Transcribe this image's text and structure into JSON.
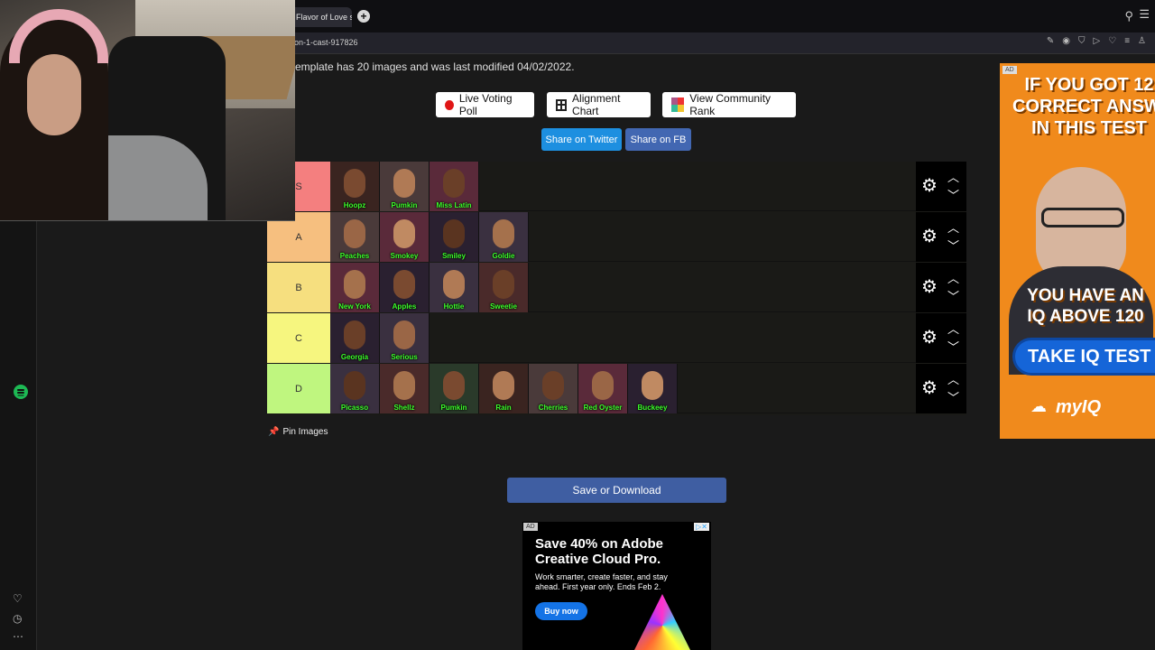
{
  "browser": {
    "tab_title": "Flavor of Love se",
    "url": "on-1-cast-917826",
    "newtab": "+",
    "search_icon": "⚲",
    "menu_icon": "☰"
  },
  "page": {
    "modified_text": "emplate has 20 images and was last modified 04/02/2022.",
    "buttons": {
      "live_voting": "Live Voting Poll",
      "alignment": "Alignment Chart",
      "community_rank": "View Community Rank"
    },
    "share": {
      "twitter": "Share on Twitter",
      "facebook": "Share on FB"
    },
    "pin_images": "Pin Images",
    "save_download": "Save or Download"
  },
  "tiers": [
    {
      "label": "S",
      "color": "#f47f7f",
      "items": [
        "Hoopz",
        "Pumkin",
        "Miss Latin"
      ]
    },
    {
      "label": "A",
      "color": "#f6bf7f",
      "items": [
        "Peaches",
        "Smokey",
        "Smiley",
        "Goldie"
      ]
    },
    {
      "label": "B",
      "color": "#f6df7f",
      "items": [
        "New York",
        "Apples",
        "Hottie",
        "Sweetie"
      ]
    },
    {
      "label": "C",
      "color": "#f6f67f",
      "items": [
        "Georgia",
        "Serious"
      ]
    },
    {
      "label": "D",
      "color": "#bff67f",
      "items": [
        "Picasso",
        "Shellz",
        "Pumkin",
        "Rain",
        "Cherries",
        "Red Oyster",
        "Buckeey"
      ]
    }
  ],
  "ads": {
    "adobe": {
      "ad_tag": "AD",
      "headline": "Save 40% on Adobe Creative Cloud Pro.",
      "subtext": "Work smarter, create faster, and stay ahead. First year only. Ends Feb 2.",
      "cta": "Buy now"
    },
    "iq": {
      "ad_tag": "AD",
      "headline_1": "IF YOU GOT 12",
      "headline_2": "CORRECT ANSWERS",
      "headline_3": "IN THIS TEST",
      "sub_1": "YOU HAVE AN",
      "sub_2": "IQ ABOVE 120",
      "cta": "TAKE IQ TEST",
      "brand": "myIQ"
    }
  },
  "colors": {
    "live_dot": "#e01616",
    "twitter": "#1d8fe0",
    "facebook": "#4267b2",
    "save": "#3f5ea2",
    "name_text": "#3cff2a"
  }
}
